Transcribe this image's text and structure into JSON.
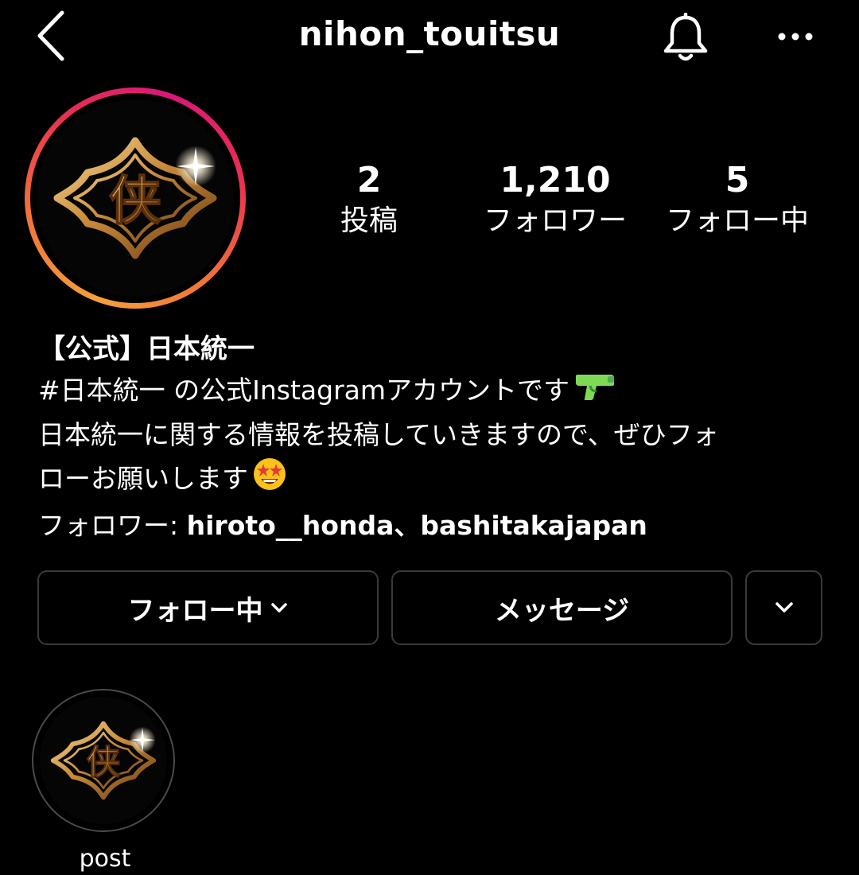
{
  "header": {
    "username": "nihon_touitsu",
    "back_icon": "chevron-left-icon",
    "bell_icon": "bell-icon",
    "more_icon": "ellipsis-icon"
  },
  "profile": {
    "logo_icon": "kyo-diamond-emblem",
    "logo_text": "侠",
    "ring_colors": [
      "#f6a03b",
      "#e8304f",
      "#d9177a"
    ]
  },
  "stats": {
    "posts": {
      "value": "2",
      "label": "投稿"
    },
    "followers": {
      "value": "1,210",
      "label": "フォロワー"
    },
    "following": {
      "value": "5",
      "label": "フォロー中"
    }
  },
  "bio": {
    "display_name": "【公式】日本統一",
    "line1_hashtag": "#日本統一",
    "line1_text": " の公式Instagramアカウントです",
    "line1_emoji": "water-pistol-emoji",
    "line2": "日本統一に関する情報を投稿していきますので、ぜひフォ",
    "line3": "ローお願いします",
    "line3_emoji": "star-struck-emoji",
    "followed_by_prefix": "フォロワー: ",
    "followed_by_users": "hiroto__honda、bashitakajapan"
  },
  "actions": {
    "follow_label": "フォロー中",
    "follow_icon": "chevron-down-icon",
    "message_label": "メッセージ",
    "more_icon": "chevron-down-icon"
  },
  "highlights": [
    {
      "label": "post",
      "icon": "kyo-diamond-emblem"
    }
  ]
}
